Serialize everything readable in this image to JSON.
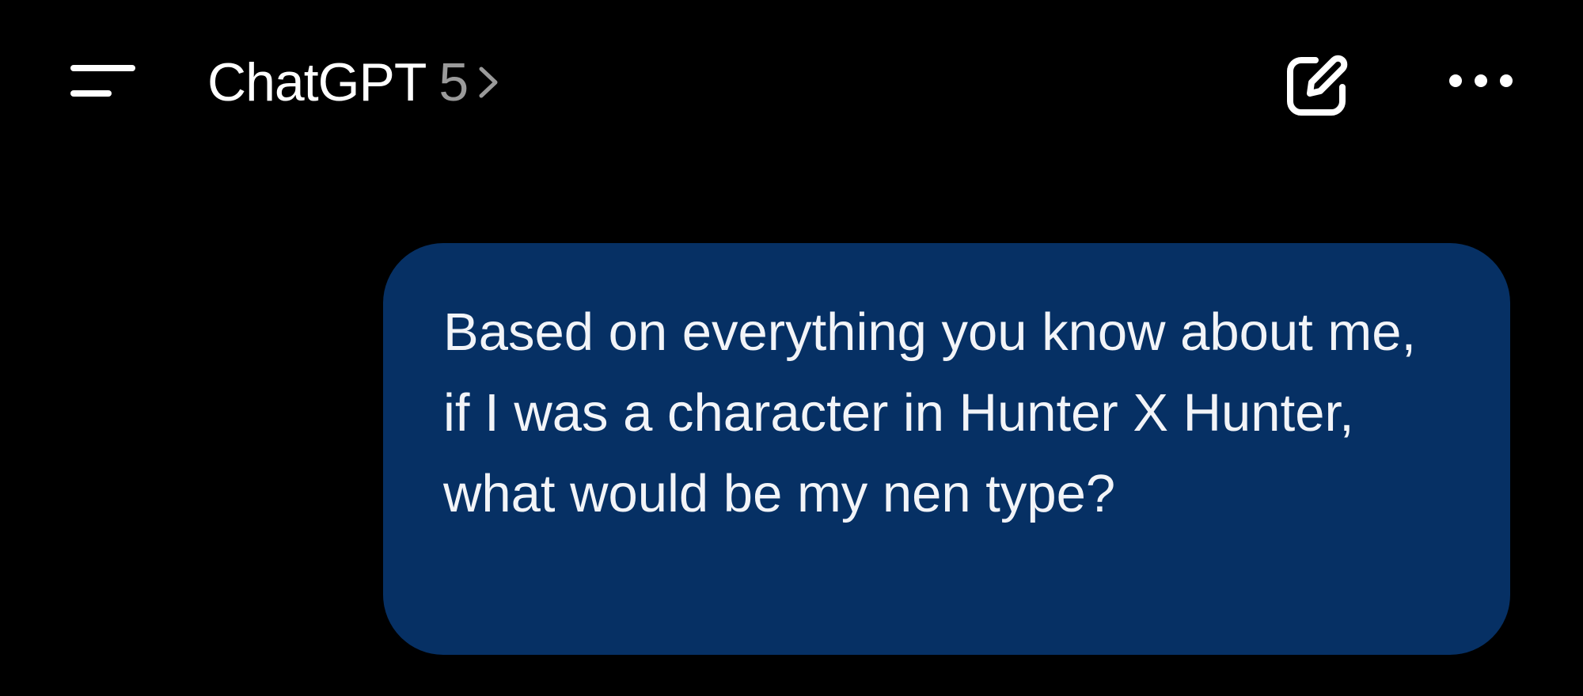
{
  "header": {
    "title": "ChatGPT",
    "model_version": "5",
    "menu_icon": "hamburger-menu-icon",
    "title_chevron_icon": "chevron-right-icon",
    "compose_icon": "new-chat-pencil-icon",
    "more_icon": "ellipsis-horizontal-icon"
  },
  "conversation": {
    "messages": [
      {
        "role": "user",
        "text": "Based on everything you know about me, if I was a character in Hunter X Hunter, what would be my nen type?"
      }
    ]
  },
  "colors": {
    "background": "#000000",
    "user_bubble": "#063064",
    "text_primary": "#ffffff",
    "text_secondary": "#9a9a9a"
  }
}
